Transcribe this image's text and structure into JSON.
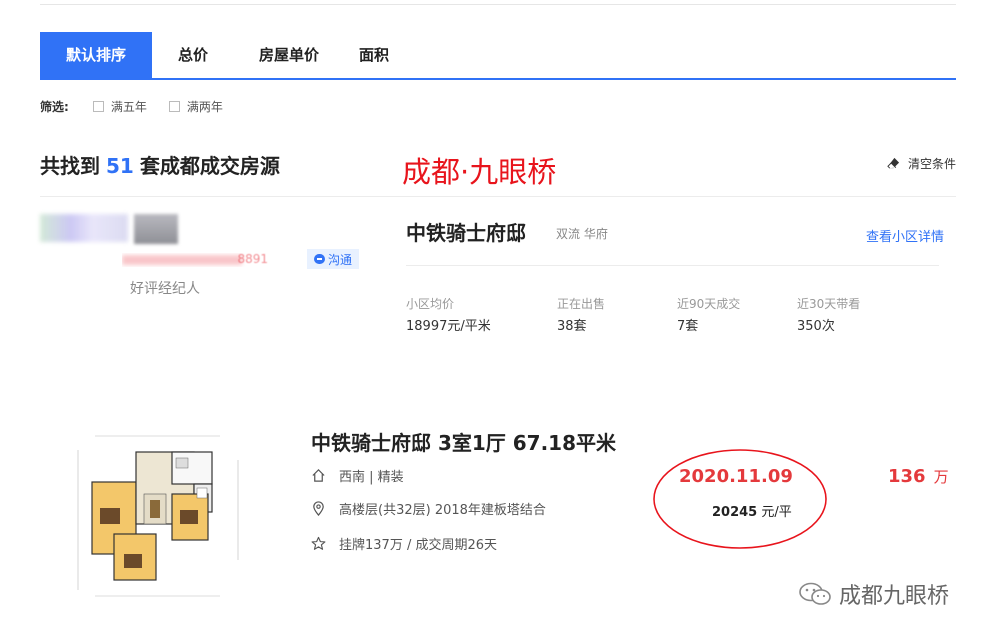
{
  "tabs": [
    {
      "label": "默认排序",
      "active": true
    },
    {
      "label": "总价",
      "active": false
    },
    {
      "label": "房屋单价",
      "active": false
    },
    {
      "label": "面积",
      "active": false
    }
  ],
  "filter": {
    "label": "筛选:",
    "options": [
      "满五年",
      "满两年"
    ]
  },
  "summary": {
    "prefix": "共找到",
    "count": "51",
    "suffix": "套成都成交房源"
  },
  "overlay_title": "成都·九眼桥",
  "clear_label": "清空条件",
  "agent": {
    "phone_tail": "8891",
    "chat_label": "沟通",
    "label": "好评经纪人"
  },
  "community": {
    "name": "中铁骑士府邸",
    "area": "双流 华府",
    "link": "查看小区详情",
    "stats": [
      {
        "label": "小区均价",
        "value": "18997元/平米"
      },
      {
        "label": "正在出售",
        "value": "38套"
      },
      {
        "label": "近90天成交",
        "value": "7套"
      },
      {
        "label": "近30天带看",
        "value": "350次"
      }
    ]
  },
  "listing": {
    "title": "中铁骑士府邸 3室1厅 67.18平米",
    "info_house": "西南 | 精装",
    "info_position": "高楼层(共32层) 2018年建板塔结合",
    "info_deal": "挂牌137万 / 成交周期26天",
    "deal_date": "2020.11.09",
    "unit_price_value": "20245",
    "unit_price_unit": "元/平",
    "total_price": "136",
    "total_unit": "万"
  },
  "watermark": "成都九眼桥",
  "colors": {
    "accent": "#3072f6",
    "price_red": "#e4393c",
    "annotation_red": "#e8141c"
  }
}
